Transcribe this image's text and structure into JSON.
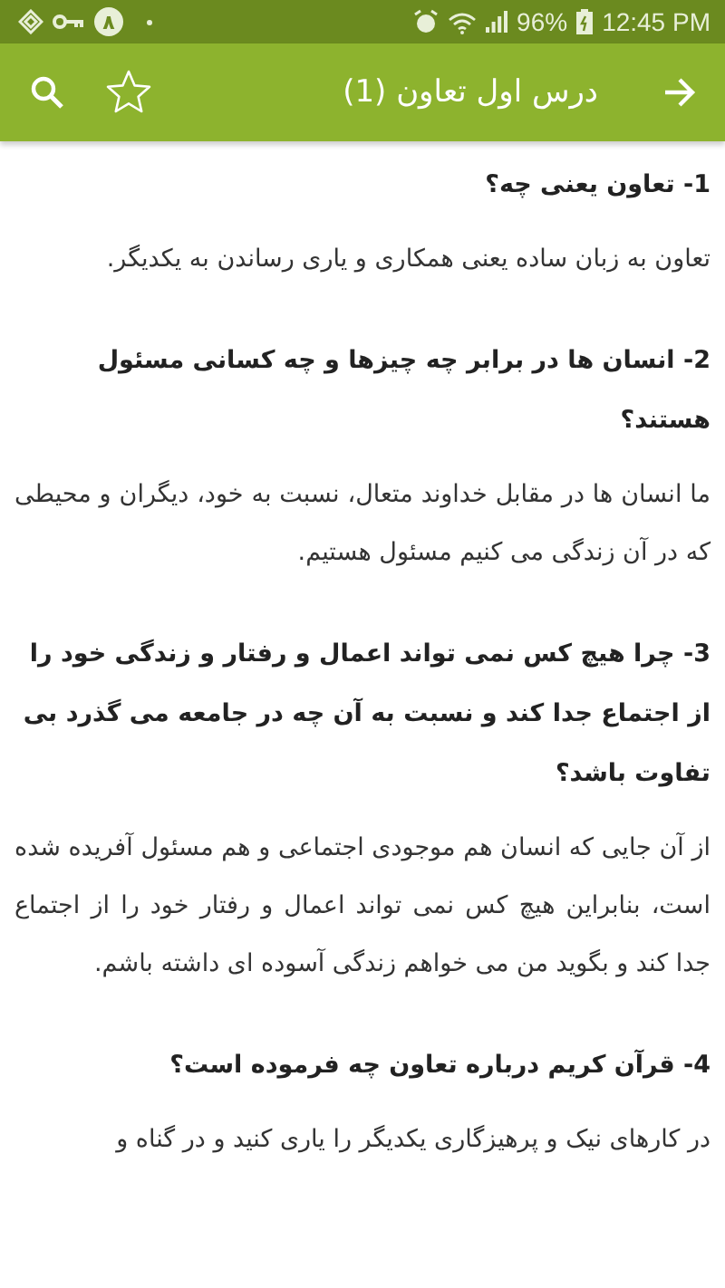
{
  "status_bar": {
    "notification_badge": "٨",
    "battery": "96%",
    "time": "12:45 PM"
  },
  "toolbar": {
    "title": "درس اول تعاون (1)",
    "starred": false
  },
  "sections": [
    {
      "question": "1- تعاون یعنی چه؟",
      "answer": "تعاون به زبان ساده یعنی همکاری و یاری رساندن به یکدیگر."
    },
    {
      "question": "2- انسان ها در برابر چه چیزها و چه کسانی مسئول هستند؟",
      "answer": "ما انسان ها در مقابل خداوند متعال، نسبت به خود، دیگران و محیطی که در آن زندگی می کنیم مسئول هستیم."
    },
    {
      "question": "3- چرا هیچ کس نمی تواند اعمال و رفتار و زندگی خود را از اجتماع جدا کند و نسبت به آن چه در جامعه می گذرد بی تفاوت باشد؟",
      "answer": "از آن جایی که انسان هم موجودی اجتماعی و هم مسئول آفریده شده است، بنابراین هیچ کس نمی تواند اعمال و رفتار خود را از اجتماع جدا کند و بگوید من می خواهم زندگی آسوده ای داشته باشم."
    },
    {
      "question": "4- قرآن کریم درباره تعاون چه فرموده است؟",
      "answer": "در کارهای نیک و پرهیزگاری یکدیگر را یاری کنید و در گناه و"
    }
  ]
}
